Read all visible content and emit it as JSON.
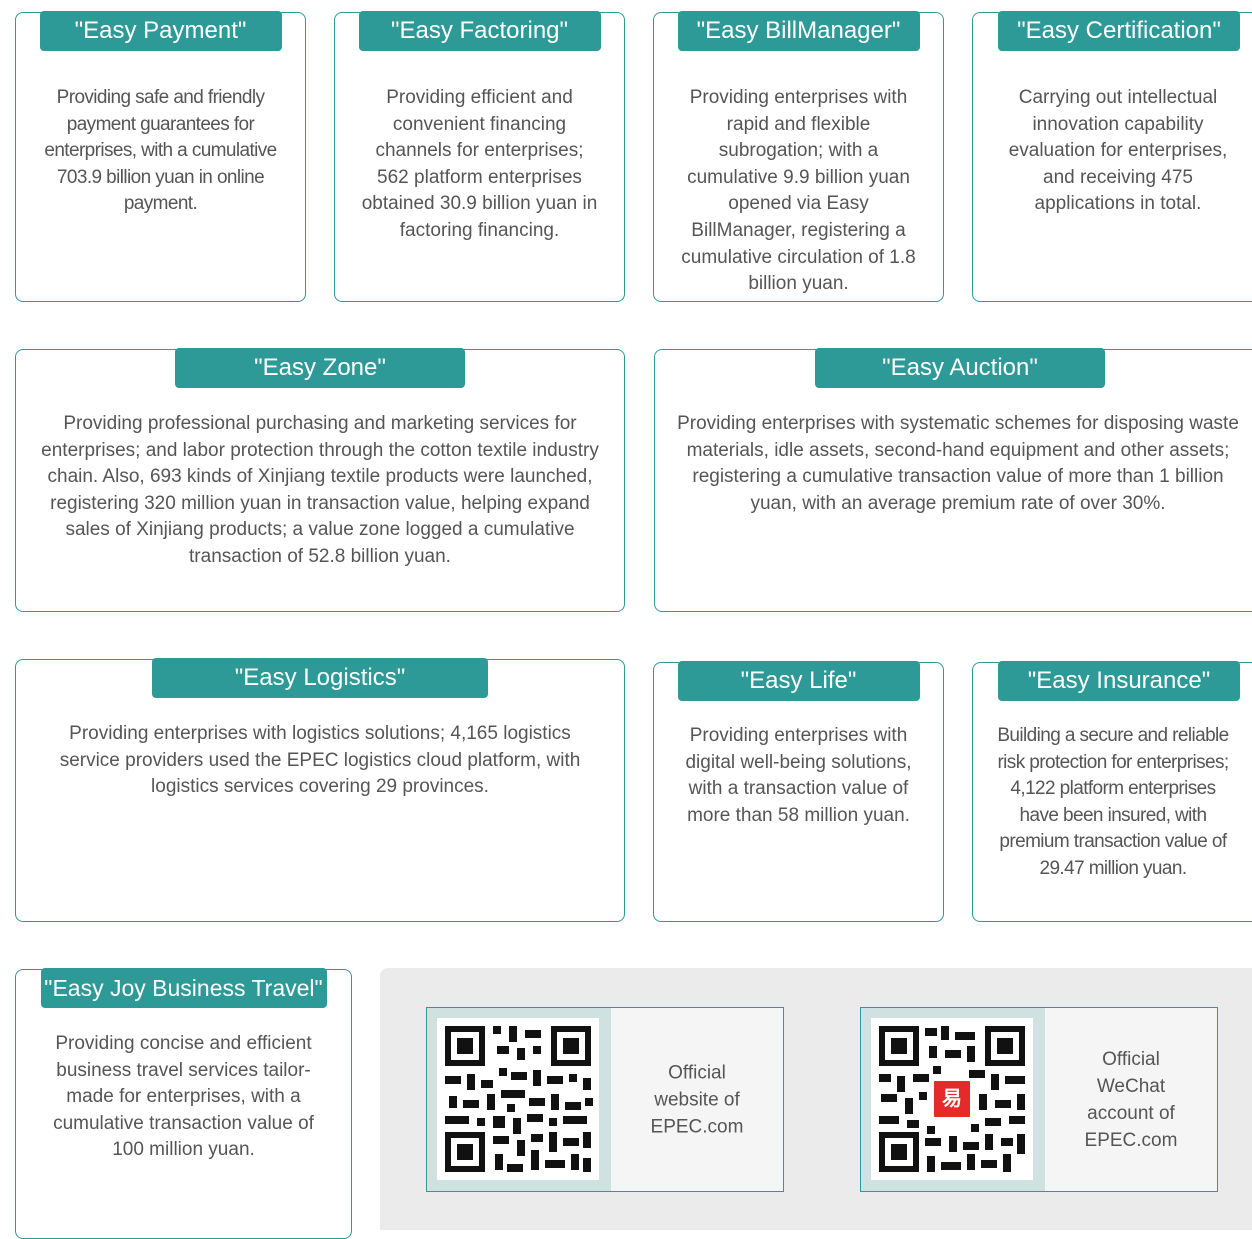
{
  "services": {
    "easy_payment": {
      "title": "\"Easy Payment\"",
      "text": "Providing safe and friendly payment guarantees for enterprises, with a cumulative 703.9 billion yuan in online payment."
    },
    "easy_factoring": {
      "title": "\"Easy Factoring\"",
      "text": "Providing efficient and convenient financing channels for enterprises; 562 platform enterprises obtained 30.9 billion yuan in factoring financing."
    },
    "easy_billmanager": {
      "title": "\"Easy BillManager\"",
      "text": "Providing enterprises with rapid and flexible subrogation; with a cumulative 9.9 billion yuan opened via Easy BillManager, registering a cumulative circulation of 1.8 billion yuan."
    },
    "easy_certification": {
      "title": "\"Easy Certification\"",
      "text": "Carrying out intellectual innovation capability evaluation for enterprises, and receiving 475 applications in total."
    },
    "easy_zone": {
      "title": "\"Easy Zone\"",
      "text": "Providing professional purchasing and marketing services for enterprises; and labor protection through the cotton textile industry chain. Also, 693 kinds of Xinjiang textile products were launched, registering 320 million yuan in transaction value, helping expand sales of Xinjiang products; a value zone logged a cumulative transaction of 52.8 billion yuan."
    },
    "easy_auction": {
      "title": "\"Easy Auction\"",
      "text": "Providing enterprises with systematic schemes for disposing waste materials, idle assets, second-hand equipment and other assets; registering a cumulative transaction value of more than 1 billion yuan, with an average premium rate of over 30%."
    },
    "easy_logistics": {
      "title": "\"Easy Logistics\"",
      "text": "Providing enterprises with logistics solutions; 4,165 logistics service providers used the EPEC logistics cloud platform, with logistics services covering 29 provinces."
    },
    "easy_life": {
      "title": "\"Easy Life\"",
      "text": "Providing enterprises with digital well-being solutions, with a transaction value of more than 58 million yuan."
    },
    "easy_insurance": {
      "title": "\"Easy Insurance\"",
      "text": "Building a secure and reliable risk protection for enterprises; 4,122 platform enterprises have been insured, with premium transaction value of 29.47 million yuan."
    },
    "easy_joy_business_travel": {
      "title": "\"Easy Joy Business Travel\"",
      "text": "Providing concise and efficient business travel services tailor-made for enterprises, with a cumulative transaction value of 100 million yuan."
    }
  },
  "qr_codes": {
    "website": {
      "label": "Official website of EPEC.com",
      "icon": "qr-code-icon"
    },
    "wechat": {
      "label": "Official WeChat account of EPEC.com",
      "icon": "qr-code-icon",
      "logo_char": "易"
    }
  },
  "colors": {
    "accent": "#2e9a97",
    "text": "#555555",
    "panel": "#ebebeb"
  }
}
